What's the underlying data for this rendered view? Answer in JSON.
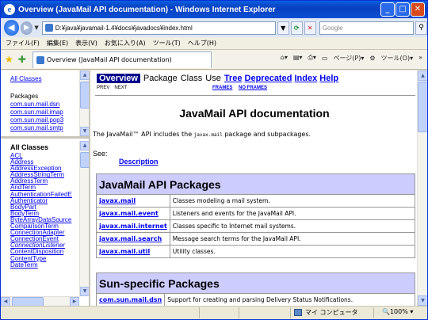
{
  "window": {
    "title": "Overview (JavaMail API documentation) - Windows Internet Explorer",
    "minimize": "_",
    "maximize": "□",
    "close": "✕"
  },
  "addressbar": {
    "url": "D:¥java¥javamail-1.4¥docs¥javadocs¥index.html",
    "search_placeholder": "Google"
  },
  "menu": [
    "ファイル(F)",
    "編集(E)",
    "表示(V)",
    "お気に入り(A)",
    "ツール(T)",
    "ヘルプ(H)"
  ],
  "tab": {
    "label": "Overview (JavaMail API documentation)"
  },
  "toolbar": {
    "page": "ページ(P)",
    "tools": "ツール(O)"
  },
  "left_frame_top": {
    "all_classes": "All Classes",
    "packages_label": "Packages",
    "packages": [
      "com.sun.mail.dsn",
      "com.sun.mail.imap",
      "com.sun.mail.pop3",
      "com.sun.mail.smtp"
    ]
  },
  "left_frame_bottom": {
    "heading": "All Classes",
    "classes": [
      {
        "name": "ACL",
        "italic": false
      },
      {
        "name": "Address",
        "italic": false
      },
      {
        "name": "AddressException",
        "italic": false
      },
      {
        "name": "AddressStringTerm",
        "italic": false
      },
      {
        "name": "AddressTerm",
        "italic": false
      },
      {
        "name": "AndTerm",
        "italic": false
      },
      {
        "name": "AuthenticationFailedE",
        "italic": false
      },
      {
        "name": "Authenticator",
        "italic": false
      },
      {
        "name": "BodyPart",
        "italic": false
      },
      {
        "name": "BodyTerm",
        "italic": false
      },
      {
        "name": "ByteArrayDataSource",
        "italic": false
      },
      {
        "name": "ComparisonTerm",
        "italic": false
      },
      {
        "name": "ConnectionAdapter",
        "italic": false
      },
      {
        "name": "ConnectionEvent",
        "italic": false
      },
      {
        "name": "ConnectionListener",
        "italic": true
      },
      {
        "name": "ContentDisposition",
        "italic": false
      },
      {
        "name": "ContentType",
        "italic": false
      },
      {
        "name": "DateTerm",
        "italic": false
      }
    ]
  },
  "main": {
    "nav": {
      "overview": "Overview",
      "package": "Package",
      "class": "Class",
      "use": "Use",
      "tree": "Tree",
      "deprecated": "Deprecated",
      "index": "Index",
      "help": "Help"
    },
    "subnav": {
      "prev": "PREV",
      "next": "NEXT",
      "frames": "FRAMES",
      "no_frames": "NO FRAMES"
    },
    "title": "JavaMail API documentation",
    "intro_before": "The JavaMail™ API includes the ",
    "intro_code": "javax.mail",
    "intro_after": " package and subpackages.",
    "see_label": "See:",
    "description_link": "Description",
    "packages_table": {
      "heading": "JavaMail API Packages",
      "rows": [
        {
          "name": "javax.mail",
          "desc": "Classes modeling a mail system."
        },
        {
          "name": "javax.mail.event",
          "desc": "Listeners and events for the JavaMail API."
        },
        {
          "name": "javax.mail.internet",
          "desc": "Classes specific to Internet mail systems."
        },
        {
          "name": "javax.mail.search",
          "desc": "Message search terms for the JavaMail API."
        },
        {
          "name": "javax.mail.util",
          "desc": "Utility classes."
        }
      ]
    },
    "sun_table": {
      "heading": "Sun-specific Packages",
      "rows": [
        {
          "name": "com.sun.mail.dsn",
          "desc": "Support for creating and parsing Delivery Status Notifications."
        }
      ]
    }
  },
  "status": {
    "zone": "マイ コンピュータ",
    "zoom": "100%"
  },
  "colors": {
    "title_bar": "#0a4fd4",
    "table_header": "#ccccff",
    "nav_selected": "#00008b",
    "link": "#0000ee"
  }
}
